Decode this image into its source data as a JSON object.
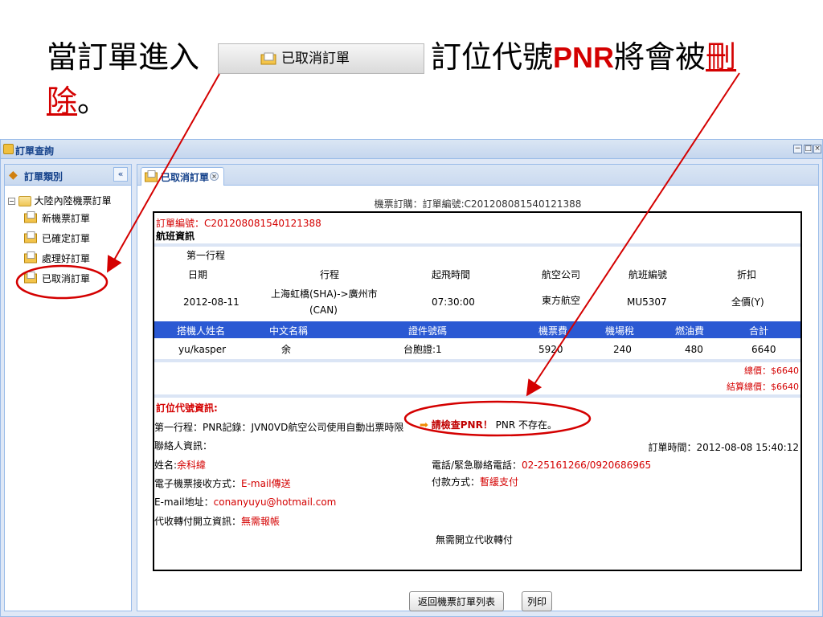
{
  "slide": {
    "part1": "當訂單進入",
    "button_label": "已取消訂單",
    "part2": "訂位代號",
    "pnr": "PNR",
    "part3": "將會被",
    "deleted_1": "刪",
    "deleted_2": "除",
    "end": "。"
  },
  "window": {
    "title": "訂單查詢"
  },
  "sidebar": {
    "header": "訂單類別",
    "collapse_glyph": "«",
    "root": "大陸內陸機票訂單",
    "items": [
      "新機票訂單",
      "已確定訂單",
      "處理好訂單",
      "已取消訂單"
    ]
  },
  "tab": {
    "label": "已取消訂單"
  },
  "order": {
    "header": "機票訂購：訂單編號:C201208081540121388",
    "number": "訂單編號：C201208081540121388",
    "section_flight": "航班資訊",
    "segment": "第一行程",
    "flight_headers": [
      "日期",
      "行程",
      "起飛時間",
      "航空公司",
      "航班編號",
      "折扣"
    ],
    "flight_row": {
      "date": "2012-08-11",
      "route_1": "上海虹橋(SHA)->廣州市",
      "route_2": "(CAN)",
      "time": "07:30:00",
      "airline": "東方航空",
      "flight_no": "MU5307",
      "discount": "全價(Y)"
    },
    "pax_headers": [
      "搭機人姓名",
      "中文名稱",
      "證件號碼",
      "機票費",
      "機場稅",
      "燃油費",
      "合計"
    ],
    "pax_row": [
      "yu/kasper",
      "余",
      "台胞證:1",
      "5920",
      "240",
      "480",
      "6640"
    ],
    "total": "總價：$6640",
    "settle_total": "結算總價：$6640",
    "pnr_section": "訂位代號資訊:",
    "pnr_line": "第一行程：PNR記錄：JVN0VD航空公司使用自動出票時限",
    "pnr_check": "請檢查PNR！",
    "pnr_missing": "PNR 不存在。",
    "contact_label": "聯絡人資訊：",
    "order_time": "訂單時間：2012-08-08 15:40:12",
    "name_label": "姓名:",
    "name_value": "余科緯",
    "phone_label": "電話/緊急聯絡電話：",
    "phone_value": "02-25161266/0920686965",
    "ticket_label": "電子機票接收方式：",
    "ticket_value": "E-mail傳送",
    "pay_label": "付款方式：",
    "pay_value": "暫緩支付",
    "email_label": "E-mail地址：",
    "email_value": "conanyuyu@hotmail.com",
    "collect_label": "代收轉付開立資訊：",
    "collect_value": "無需報帳",
    "no_collect": "無需開立代收轉付"
  },
  "buttons": {
    "back": "返回機票訂單列表",
    "print": "列印"
  },
  "colors": {
    "accent_red": "#d40000",
    "grid_blue": "#2b59d3",
    "panel_border": "#99bbe8"
  }
}
